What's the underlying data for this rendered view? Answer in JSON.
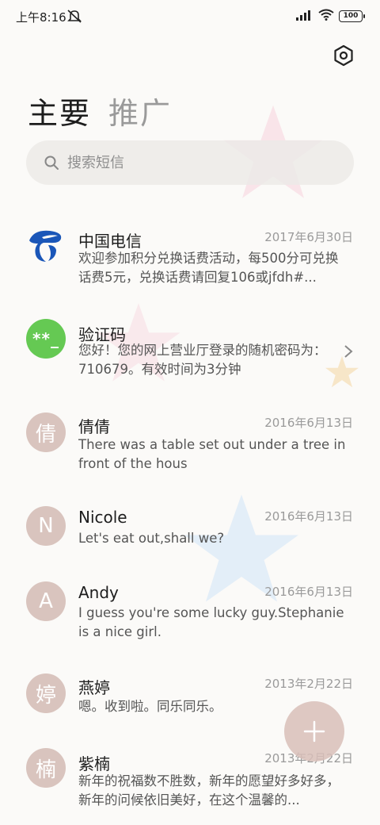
{
  "status": {
    "time": "上午8:16",
    "battery": "100"
  },
  "tabs": {
    "main": "主要",
    "promo": "推广"
  },
  "search": {
    "placeholder": "搜索短信"
  },
  "messages": [
    {
      "name": "中国电信",
      "date": "2017年6月30日",
      "preview": "欢迎参加积分兑换话费活动，每500分可兑换话费5元，兑换话费请回复106或jfdh#...",
      "avatar": "telecom-logo"
    },
    {
      "name": "验证码",
      "date": "",
      "preview": "您好！您的网上营业厅登录的随机密码为：710679。有效时间为3分钟",
      "avatar": "**_"
    },
    {
      "name": "倩倩",
      "date": "2016年6月13日",
      "preview": "There was a table set out under a tree in front of the hous",
      "avatar": "倩"
    },
    {
      "name": "Nicole",
      "date": "2016年6月13日",
      "preview": "Let's eat out,shall we?",
      "avatar": "N"
    },
    {
      "name": "Andy",
      "date": "2016年6月13日",
      "preview": "I guess you're some lucky guy.Stephanie is a nice girl.",
      "avatar": "A"
    },
    {
      "name": "燕婷",
      "date": "2013年2月22日",
      "preview": "嗯。收到啦。同乐同乐。",
      "avatar": "婷"
    },
    {
      "name": "紫楠",
      "date": "2013年2月22日",
      "preview": "新年的祝福数不胜数，新年的愿望好多好多，新年的问候依旧美好，在这个温馨的...",
      "avatar": "楠"
    }
  ],
  "colors": {
    "accent_avatar": "#d9c4be",
    "code_avatar": "#65c953",
    "telecom_blue": "#1a56b8"
  }
}
